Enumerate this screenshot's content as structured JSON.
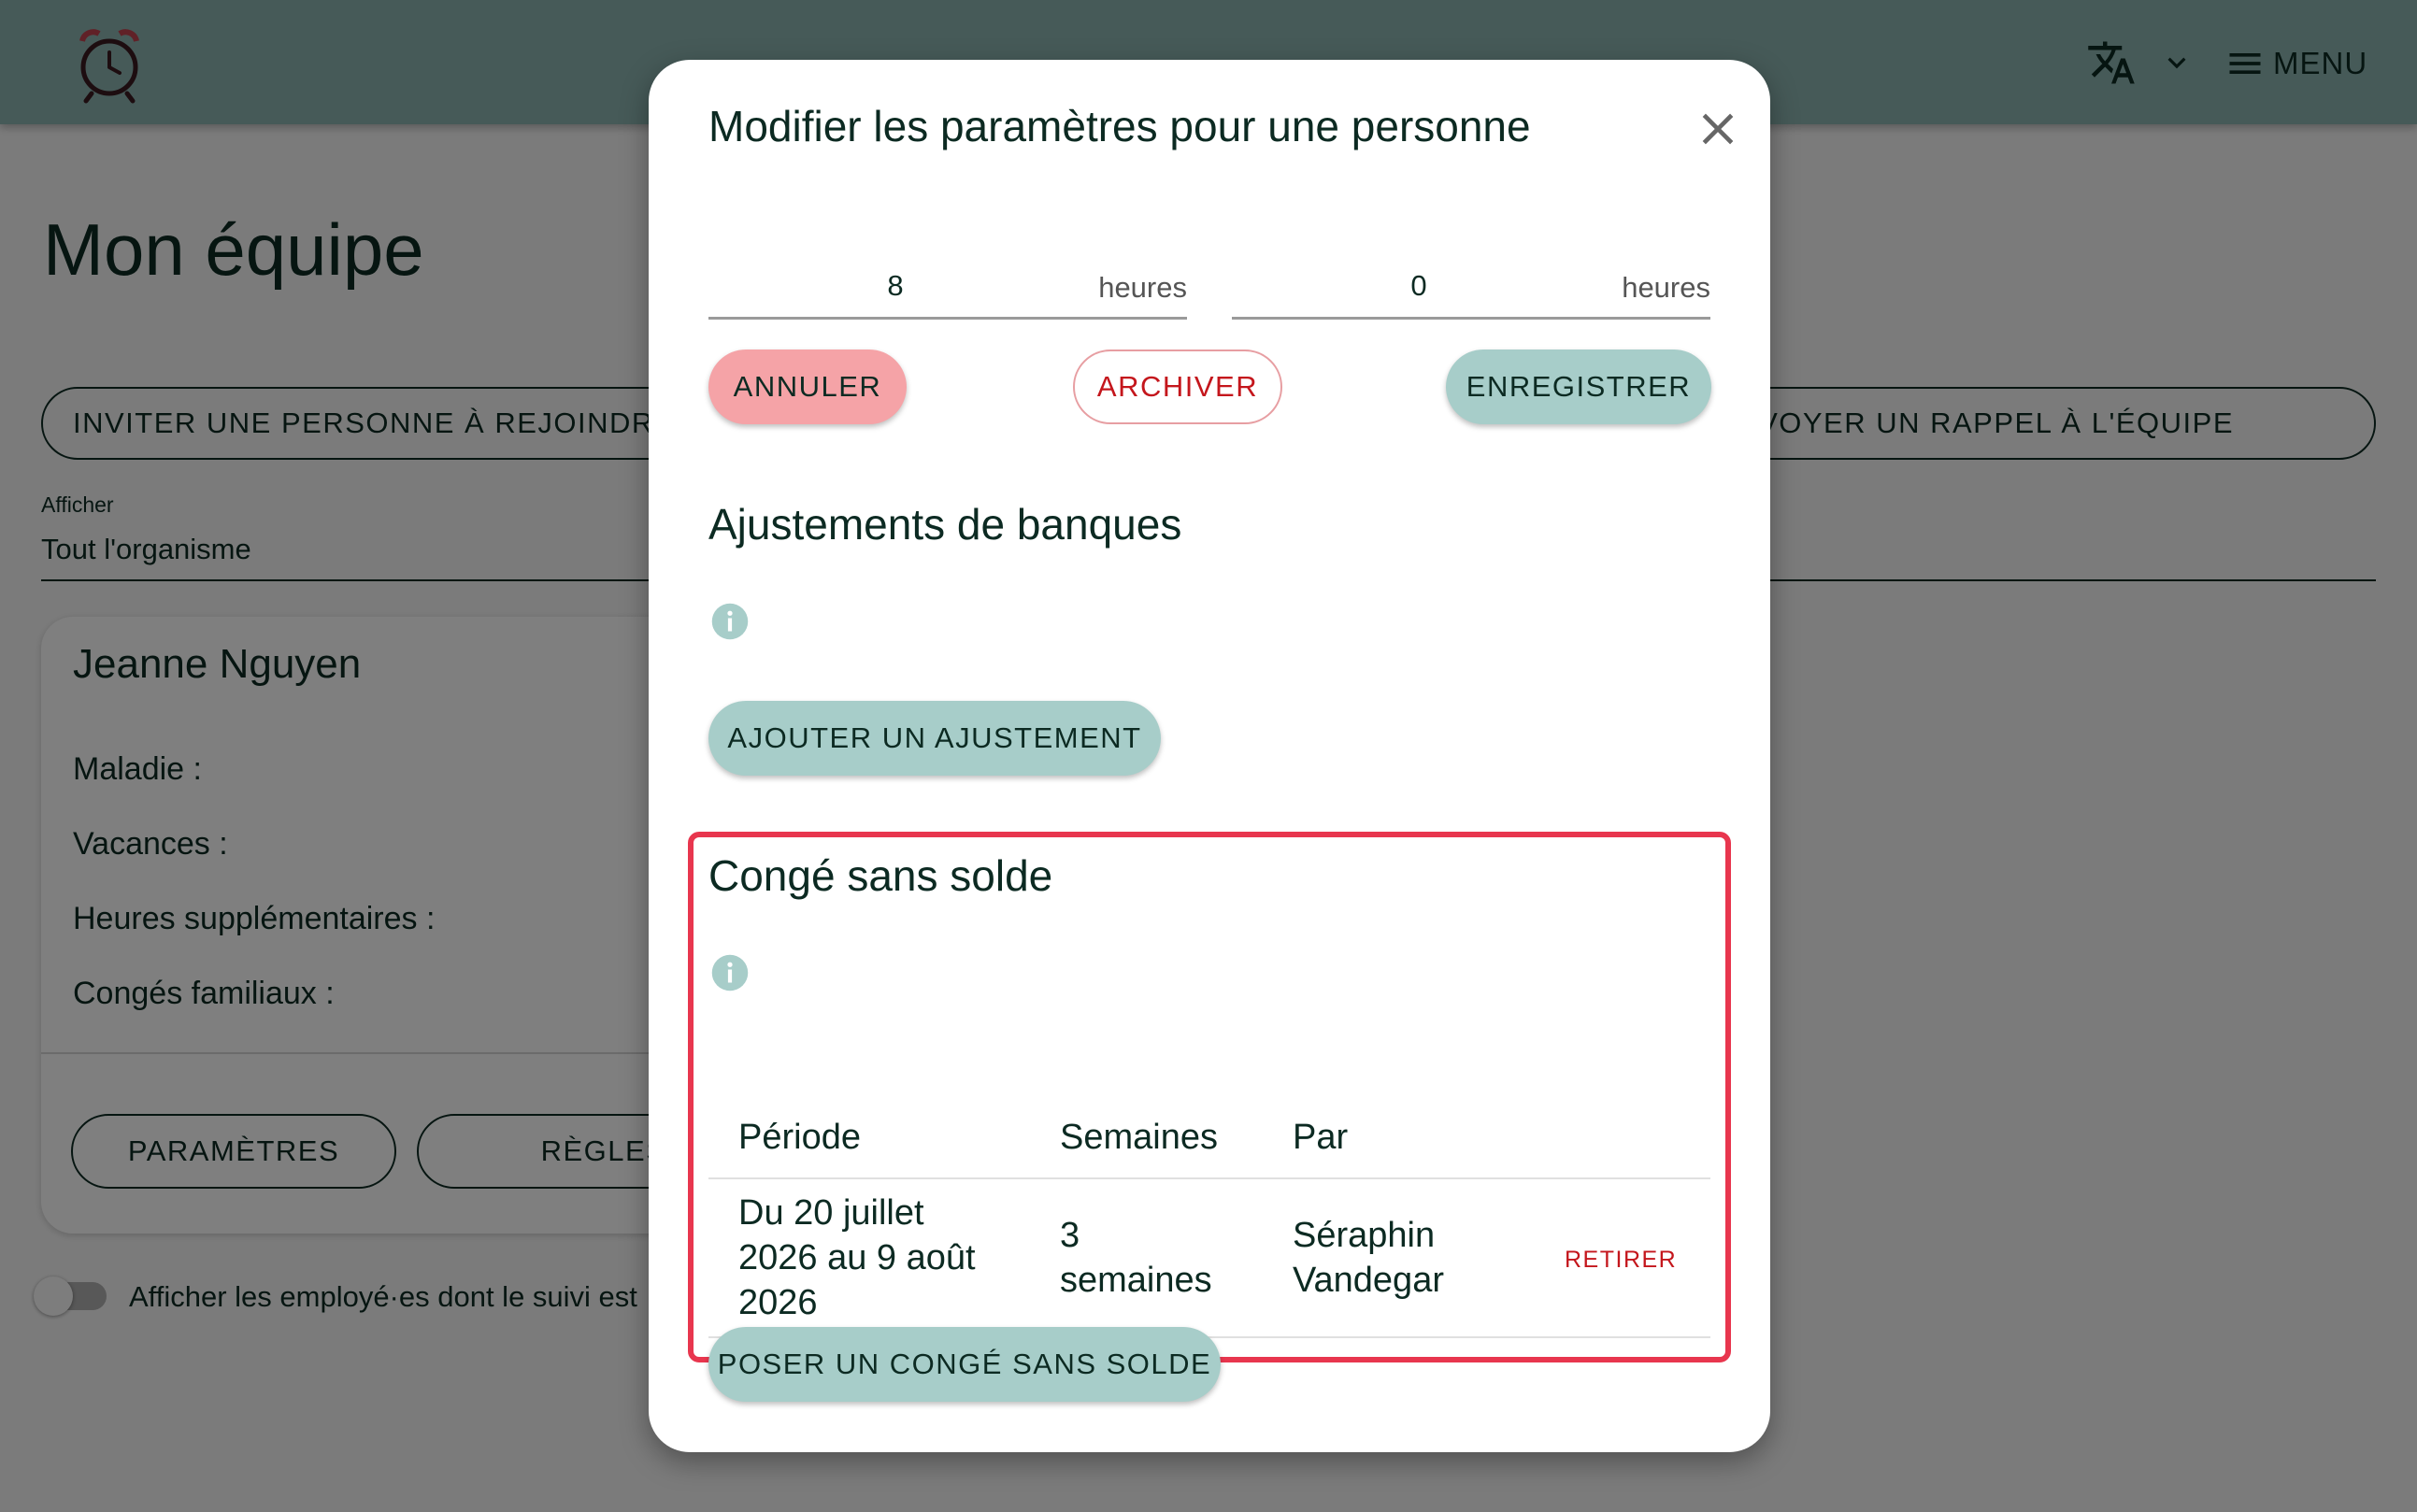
{
  "header": {
    "menu_label": "MENU",
    "logo_icon": "alarm-clock-icon",
    "language_icon": "translate-icon",
    "chevron_icon": "chevron-down-icon",
    "menu_icon": "hamburger-icon"
  },
  "page": {
    "title": "Mon équipe",
    "invite_button": "INVITER UNE PERSONNE À REJOINDRE L",
    "reminder_button": "ENVOYER UN RAPPEL À L'ÉQUIPE",
    "filter_label": "Afficher",
    "filter_value": "Tout l'organisme",
    "toggle_label": "Afficher les employé·es dont le suivi est"
  },
  "employee_card": {
    "name": "Jeanne Nguyen",
    "fields": [
      "Maladie :",
      "Vacances :",
      "Heures supplémentaires :",
      "Congés familiaux :"
    ],
    "settings_button": "PARAMÈTRES",
    "rules_button": "RÈGLES"
  },
  "modal": {
    "title": "Modifier les paramètres pour une personne",
    "hours_fields": [
      {
        "value": "8",
        "unit": "heures"
      },
      {
        "value": "0",
        "unit": "heures"
      }
    ],
    "cancel_button": "ANNULER",
    "archive_button": "ARCHIVER",
    "save_button": "ENREGISTRER",
    "bank_section_title": "Ajustements de banques",
    "add_adjustment_button": "AJOUTER UN AJUSTEMENT",
    "unpaid_section_title": "Congé sans solde",
    "table": {
      "headers": [
        "Période",
        "Semaines",
        "Par"
      ],
      "rows": [
        {
          "period_lines": [
            "Du 20 juillet",
            "2026 au 9 août",
            "2026"
          ],
          "weeks_lines": [
            "3",
            "semaines"
          ],
          "by_lines": [
            "Séraphin",
            "Vandegar"
          ],
          "action": "RETIRER"
        }
      ]
    },
    "add_unpaid_button": "POSER UN CONGÉ SANS SOLDE"
  },
  "colors": {
    "header_bg": "#8cb4b0",
    "primary_button": "#a7cdc9",
    "cancel_button": "#f5a3a7",
    "danger_text": "#c4161c",
    "highlight_border": "#e8364e",
    "text_dark": "#0c2a22"
  }
}
